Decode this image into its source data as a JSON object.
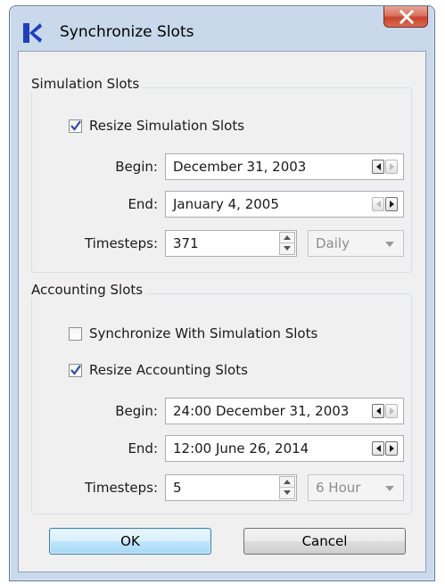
{
  "window": {
    "title": "Synchronize Slots",
    "close_label": "X",
    "colors": {
      "frame": "#c9d8ea",
      "close_button": "#c7432e",
      "accent": "#1f3fbf"
    }
  },
  "simulation": {
    "group_label": "Simulation Slots",
    "resize": {
      "label": "Resize Simulation Slots",
      "checked": true
    },
    "begin": {
      "label": "Begin:",
      "value": "December 31, 2003"
    },
    "end": {
      "label": "End:",
      "value": "January 4, 2005"
    },
    "timesteps": {
      "label": "Timesteps:",
      "value": "371",
      "unit": "Daily"
    }
  },
  "accounting": {
    "group_label": "Accounting Slots",
    "sync": {
      "label": "Synchronize With Simulation Slots",
      "checked": false
    },
    "resize": {
      "label": "Resize Accounting Slots",
      "checked": true
    },
    "begin": {
      "label": "Begin:",
      "value": "24:00 December 31, 2003"
    },
    "end": {
      "label": "End:",
      "value": "12:00 June 26, 2014"
    },
    "timesteps": {
      "label": "Timesteps:",
      "value": "5",
      "unit": "6 Hour"
    }
  },
  "buttons": {
    "ok": "OK",
    "cancel": "Cancel"
  }
}
